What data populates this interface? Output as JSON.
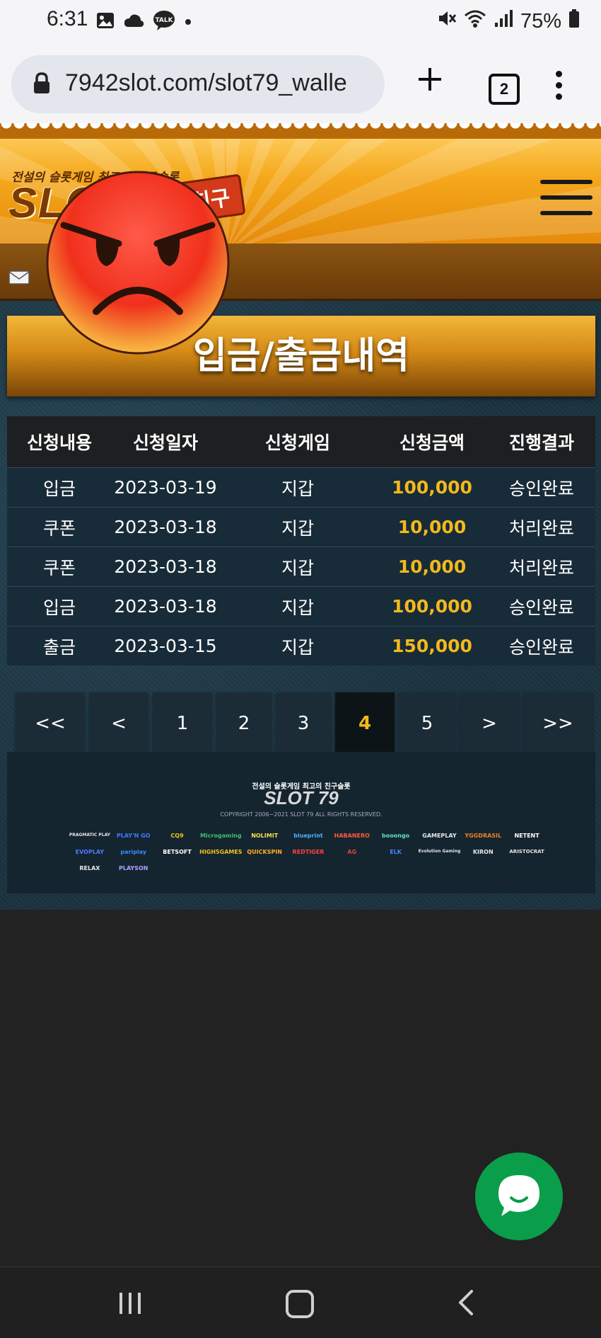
{
  "status_bar": {
    "time": "6:31",
    "left_icons": [
      "gallery-icon",
      "cloud-icon",
      "talk-icon",
      "dot-icon"
    ],
    "talk_label": "TALK",
    "right_icons": [
      "mute-icon",
      "wifi-icon",
      "signal-icon",
      "battery-icon"
    ],
    "battery": "75%"
  },
  "browser": {
    "url": "7942slot.com/slot79_walle",
    "tab_count": "2"
  },
  "site": {
    "logo_tagline": "전설의 슬롯게임 최고의 친구슬롯",
    "logo_text": "SLOT",
    "logo_badge": "친구"
  },
  "page": {
    "title": "입금/출금내역"
  },
  "table": {
    "headers": [
      "신청내용",
      "신청일자",
      "신청게임",
      "신청금액",
      "진행결과"
    ],
    "rows": [
      [
        "입금",
        "2023-03-19",
        "지갑",
        "100,000",
        "승인완료"
      ],
      [
        "쿠폰",
        "2023-03-18",
        "지갑",
        "10,000",
        "처리완료"
      ],
      [
        "쿠폰",
        "2023-03-18",
        "지갑",
        "10,000",
        "처리완료"
      ],
      [
        "입금",
        "2023-03-18",
        "지갑",
        "100,000",
        "승인완료"
      ],
      [
        "출금",
        "2023-03-15",
        "지갑",
        "150,000",
        "승인완료"
      ]
    ],
    "amount_color": "#f2b91c"
  },
  "pagination": {
    "items": [
      "<<",
      "<",
      "1",
      "2",
      "3",
      "4",
      "5",
      ">",
      ">>"
    ],
    "current": "4"
  },
  "footer": {
    "tagline": "전설의 슬롯게임 최고의 친구슬롯",
    "logo": "SLOT 79",
    "copyright": "COPYRIGHT 2006~2021 SLOT 79 ALL RIGHTS RESERVED.",
    "providers": [
      "PRAGMATIC PLAY",
      "PLAY'N GO",
      "CQ9",
      "Microgaming",
      "NOLIMIT",
      "blueprint",
      "HABANERO",
      "booongo",
      "GAMEPLAY",
      "YGGDRASIL",
      "NETENT",
      "EVOPLAY",
      "pariplay",
      "BETSOFT",
      "HIGH5GAMES",
      "QUICKSPIN",
      "REDTIGER",
      "AG",
      "ELK",
      "Evolution Gaming",
      "KIRON",
      "ARISTOCRAT",
      "RELAX",
      "PLAYSON"
    ]
  },
  "colors": {
    "accent_gold": "#f2b91c",
    "chat_green": "#0a9e4a",
    "header_orange": "#f5a81c"
  }
}
